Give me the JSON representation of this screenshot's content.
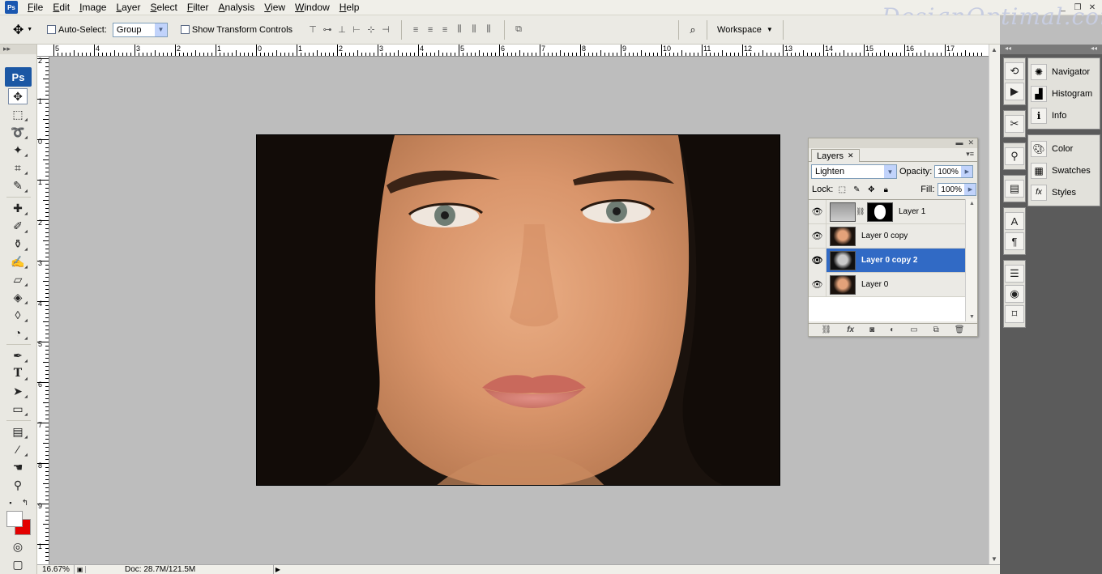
{
  "app": {
    "icon_label": "Ps",
    "watermark": "DesignOptimal.com"
  },
  "menu": [
    "File",
    "Edit",
    "Image",
    "Layer",
    "Select",
    "Filter",
    "Analysis",
    "View",
    "Window",
    "Help"
  ],
  "window_controls": [
    "_",
    "❐",
    "✕"
  ],
  "options": {
    "auto_select_label": "Auto-Select:",
    "auto_select_value": "Group",
    "show_transform_label": "Show Transform Controls",
    "workspace_label": "Workspace"
  },
  "toolbox": {
    "logo": "Ps"
  },
  "ruler_h": [
    "5",
    "4",
    "3",
    "2",
    "1",
    "0",
    "1",
    "2",
    "3",
    "4",
    "5",
    "6",
    "7",
    "8",
    "9",
    "10",
    "11",
    "12",
    "13",
    "14",
    "15",
    "16",
    "17"
  ],
  "ruler_v": [
    "2",
    "1",
    "0",
    "1",
    "2",
    "3",
    "4",
    "5",
    "6",
    "7",
    "8",
    "9",
    "1"
  ],
  "status": {
    "zoom": "16.67%",
    "doc": "Doc: 28.7M/121.5M"
  },
  "layers_panel": {
    "tab_label": "Layers",
    "blend_mode": "Lighten",
    "opacity_label": "Opacity:",
    "opacity_value": "100%",
    "lock_label": "Lock:",
    "fill_label": "Fill:",
    "fill_value": "100%",
    "layers": [
      {
        "name": "Layer 1",
        "visible": true,
        "selected": false,
        "has_mask": true
      },
      {
        "name": "Layer 0 copy",
        "visible": true,
        "selected": false,
        "has_mask": false
      },
      {
        "name": "Layer 0 copy 2",
        "visible": true,
        "selected": true,
        "has_mask": false
      },
      {
        "name": "Layer 0",
        "visible": true,
        "selected": false,
        "has_mask": false
      }
    ]
  },
  "dock": {
    "group1": [
      "Navigator",
      "Histogram",
      "Info"
    ],
    "group2": [
      "Color",
      "Swatches",
      "Styles"
    ]
  },
  "colors": {
    "selection": "#316ac5",
    "background_swatch": "#e40000",
    "foreground_swatch": "#ffffff"
  }
}
